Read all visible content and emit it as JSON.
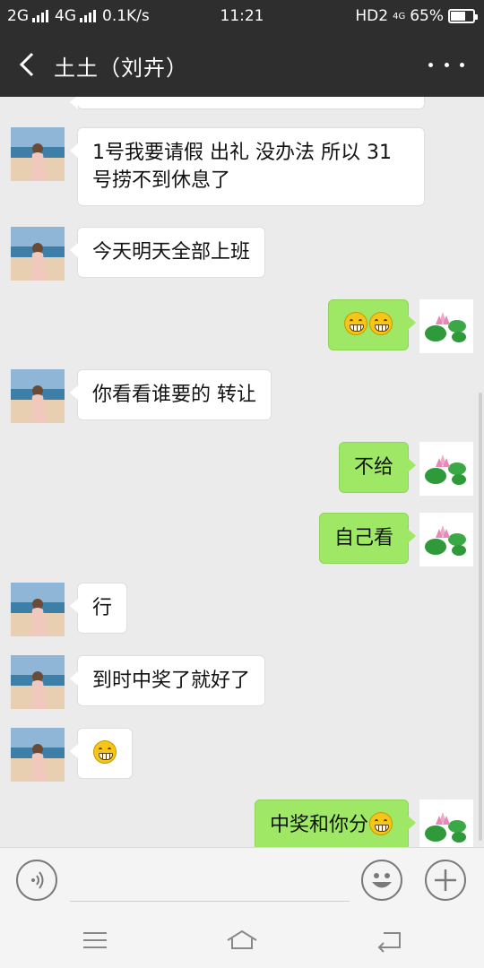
{
  "status_bar": {
    "net_2g": "2G",
    "net_4g": "4G",
    "speed": "0.1K/s",
    "time": "11:21",
    "hd": "HD2",
    "net_4g_small": "4G",
    "battery_text": "65%",
    "battery_level": 0.65
  },
  "header": {
    "title": "土土（刘卉）",
    "back_icon": "chevron-left-icon",
    "more_icon": "more-dots-icon"
  },
  "messages": [
    {
      "from": "them",
      "text": "1号我要请假 出礼 没办法 所以 31"
    },
    {
      "from": "them",
      "text": "号捞不到休息了"
    },
    {
      "from": "them",
      "text": "今天明天全部上班"
    },
    {
      "from": "me",
      "emoji_count": 2
    },
    {
      "from": "them",
      "text": "你看看谁要的 转让"
    },
    {
      "from": "me",
      "text": "不给"
    },
    {
      "from": "me",
      "text": "自己看"
    },
    {
      "from": "them",
      "text": "行"
    },
    {
      "from": "them",
      "text": "到时中奖了就好了"
    },
    {
      "from": "them",
      "emoji_count": 1
    },
    {
      "from": "me",
      "text": "中奖和你分"
    }
  ],
  "input_bar": {
    "voice_icon": "voice-icon",
    "emoji_icon": "emoji-icon",
    "plus_icon": "plus-icon",
    "placeholder": ""
  },
  "nav_bar": {
    "menu_icon": "menu-icon",
    "home_icon": "home-icon",
    "back_icon": "back-icon"
  },
  "colors": {
    "header_bg": "#2e2e2e",
    "chat_bg": "#ebebeb",
    "out_bubble": "#9fe866",
    "in_bubble": "#ffffff"
  }
}
